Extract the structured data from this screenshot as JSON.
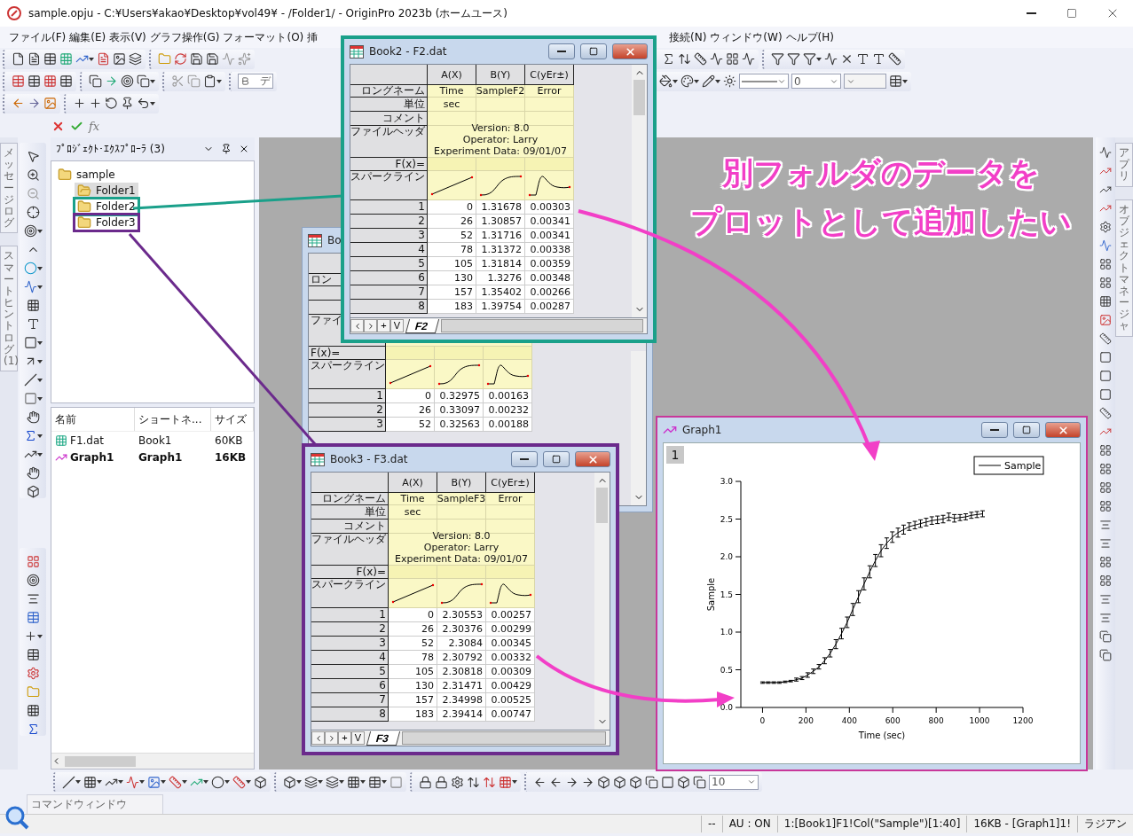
{
  "titlebar": {
    "title": "sample.opju - C:¥Users¥akao¥Desktop¥vol49¥ - /Folder1/ - OriginPro 2023b (ホームユース)"
  },
  "menu": {
    "left": [
      "ファイル(F)",
      "編集(E)",
      "表示(V)",
      "グラフ操作(G)",
      "フォーマット(O)",
      "挿"
    ],
    "right": [
      "接続(N)",
      "ウィンドウ(W)",
      "ヘルプ(H)"
    ]
  },
  "style_toolbar": {
    "font_field": "デ",
    "width_field": "0"
  },
  "formula_bar": {
    "fx": "fx"
  },
  "side_tabs": {
    "left": [
      "メッセージログ",
      "スマートヒントログ (1)"
    ],
    "right": [
      "アプリ",
      "オブジェクトマネージャ"
    ]
  },
  "project_explorer": {
    "title": "ﾌﾟﾛｼﾞｪｸﾄ･ｴｸｽﾌﾟﾛｰﾗ (3)",
    "tree": [
      {
        "label": "sample",
        "selected": false,
        "children": [
          {
            "label": "Folder1",
            "selected": true
          },
          {
            "label": "Folder2",
            "selected": false,
            "color": "#1aa08a"
          },
          {
            "label": "Folder3",
            "selected": false,
            "color": "#6b2a8c"
          }
        ]
      }
    ],
    "columns": [
      "名前",
      "ショートネ...",
      "サイズ"
    ],
    "items": [
      {
        "kind": "workbook",
        "name": "F1.dat",
        "short_name": "Book1",
        "size": "60KB",
        "active": false
      },
      {
        "kind": "graph",
        "name": "Graph1",
        "short_name": "Graph1",
        "size": "16KB",
        "active": true
      }
    ]
  },
  "workbooks": [
    {
      "title": "Bo",
      "row_labels": {
        "long_name": "ロン",
        "file_header": "ファイ",
        "formula": "F(x)=",
        "sparkline": "スパークライン"
      },
      "columns": [
        {
          "kind": "linear"
        },
        {
          "kind": "sigmoid"
        },
        {
          "kind": "peak"
        }
      ],
      "rows": [
        {
          "number": "1",
          "cells": [
            "0",
            "0.32975",
            "0.00163"
          ]
        },
        {
          "number": "2",
          "cells": [
            "26",
            "0.33097",
            "0.00232"
          ]
        },
        {
          "number": "3",
          "cells": [
            "52",
            "0.32563",
            "0.00188"
          ]
        }
      ]
    },
    {
      "title": "Book2 - F2.dat",
      "color": "#1aa08a",
      "row_labels": {
        "long_name": "ロングネーム",
        "units": "単位",
        "comment": "コメント",
        "file_header": "ファイルヘッダ",
        "formula": "F(x)=",
        "sparkline": "スパークライン"
      },
      "columns": [
        {
          "label": "A(X)",
          "long_name": "Time",
          "units": "sec",
          "kind": "linear"
        },
        {
          "label": "B(Y)",
          "long_name": "SampleF2",
          "kind": "sigmoid"
        },
        {
          "label": "C(yEr±)",
          "long_name": "Error",
          "kind": "peak"
        }
      ],
      "file_header": [
        "Version: 8.0",
        "Operator: Larry",
        "Experiment Data: 09/01/07"
      ],
      "rows": [
        {
          "number": "1",
          "cells": [
            "0",
            "1.31678",
            "0.00303"
          ]
        },
        {
          "number": "2",
          "cells": [
            "26",
            "1.30857",
            "0.00341"
          ]
        },
        {
          "number": "3",
          "cells": [
            "52",
            "1.31716",
            "0.00341"
          ]
        },
        {
          "number": "4",
          "cells": [
            "78",
            "1.31372",
            "0.00338"
          ]
        },
        {
          "number": "5",
          "cells": [
            "105",
            "1.31814",
            "0.00359"
          ]
        },
        {
          "number": "6",
          "cells": [
            "130",
            "1.3276",
            "0.00348"
          ]
        },
        {
          "number": "7",
          "cells": [
            "157",
            "1.35402",
            "0.00266"
          ]
        },
        {
          "number": "8",
          "cells": [
            "183",
            "1.39754",
            "0.00287"
          ]
        }
      ],
      "sheet_nav": [
        "+",
        "V"
      ],
      "sheet_tab": "F2"
    },
    {
      "title": "Book3 - F3.dat",
      "color": "#6b2a8c",
      "row_labels": {
        "long_name": "ロングネーム",
        "units": "単位",
        "comment": "コメント",
        "file_header": "ファイルヘッダ",
        "formula": "F(x)=",
        "sparkline": "スパークライン"
      },
      "columns": [
        {
          "label": "A(X)",
          "long_name": "Time",
          "units": "sec",
          "kind": "linear"
        },
        {
          "label": "B(Y)",
          "long_name": "SampleF3",
          "kind": "sigmoid"
        },
        {
          "label": "C(yEr±)",
          "long_name": "Error",
          "kind": "peak"
        }
      ],
      "file_header": [
        "Version: 8.0",
        "Operator: Larry",
        "Experiment Data: 09/01/07"
      ],
      "rows": [
        {
          "number": "1",
          "cells": [
            "0",
            "2.30553",
            "0.00257"
          ]
        },
        {
          "number": "2",
          "cells": [
            "26",
            "2.30376",
            "0.00299"
          ]
        },
        {
          "number": "3",
          "cells": [
            "52",
            "2.3084",
            "0.00345"
          ]
        },
        {
          "number": "4",
          "cells": [
            "78",
            "2.30792",
            "0.00332"
          ]
        },
        {
          "number": "5",
          "cells": [
            "105",
            "2.30818",
            "0.00309"
          ]
        },
        {
          "number": "6",
          "cells": [
            "130",
            "2.31471",
            "0.00429"
          ]
        },
        {
          "number": "7",
          "cells": [
            "157",
            "2.34998",
            "0.00525"
          ]
        },
        {
          "number": "8",
          "cells": [
            "183",
            "2.39414",
            "0.00747"
          ]
        }
      ],
      "sheet_nav": [
        "+",
        "V"
      ],
      "sheet_tab": "F3"
    }
  ],
  "graph": {
    "title": "Graph1",
    "color": "#c8379a",
    "layer": "1",
    "chart_data": {
      "type": "line",
      "xlabel": "Time (sec)",
      "ylabel": "Sample",
      "xlim": [
        -100,
        1200
      ],
      "ylim": [
        0,
        3
      ],
      "xticks": [
        0,
        200,
        400,
        600,
        800,
        1000,
        1200
      ],
      "yticks": [
        {
          "value": 0,
          "label": "0.0"
        },
        {
          "value": 0.5,
          "label": "0.5"
        },
        {
          "value": 1,
          "label": "1.0"
        },
        {
          "value": 1.5,
          "label": "1.5"
        },
        {
          "value": 2,
          "label": "2.0"
        },
        {
          "value": 2.5,
          "label": "2.5"
        },
        {
          "value": 3,
          "label": "3.0"
        }
      ],
      "x": [
        0,
        26,
        52,
        78,
        104,
        130,
        156,
        182,
        208,
        234,
        260,
        286,
        312,
        338,
        364,
        390,
        416,
        442,
        468,
        494,
        520,
        546,
        572,
        598,
        624,
        650,
        676,
        702,
        728,
        754,
        780,
        806,
        832,
        858,
        884,
        910,
        936,
        962,
        988,
        1014
      ],
      "series": [
        {
          "name": "Sample",
          "color": "#000000",
          "values": [
            0.33,
            0.33,
            0.33,
            0.33,
            0.34,
            0.35,
            0.37,
            0.39,
            0.43,
            0.48,
            0.54,
            0.62,
            0.72,
            0.84,
            0.98,
            1.13,
            1.3,
            1.47,
            1.64,
            1.8,
            1.95,
            2.08,
            2.18,
            2.26,
            2.32,
            2.36,
            2.4,
            2.42,
            2.44,
            2.46,
            2.48,
            2.49,
            2.5,
            2.53,
            2.51,
            2.52,
            2.53,
            2.55,
            2.56,
            2.57
          ],
          "errors": [
            0.01,
            0.01,
            0.01,
            0.01,
            0.01,
            0.01,
            0.02,
            0.02,
            0.03,
            0.03,
            0.03,
            0.04,
            0.05,
            0.06,
            0.07,
            0.07,
            0.08,
            0.08,
            0.08,
            0.08,
            0.08,
            0.08,
            0.07,
            0.07,
            0.06,
            0.06,
            0.05,
            0.05,
            0.05,
            0.05,
            0.05,
            0.05,
            0.05,
            0.05,
            0.05,
            0.04,
            0.04,
            0.04,
            0.04,
            0.04
          ]
        }
      ]
    }
  },
  "annotation": [
    "別フォルダのデータを",
    "プロットとして追加したい"
  ],
  "bottom_toolbar": {
    "size_field": "10"
  },
  "command_window": {
    "label": "コマンドウィンドウ"
  },
  "status_bar": [
    "--",
    "AU : ON",
    "1:[Book1]F1!Col(\"Sample\")[1:40]",
    "16KB - [Graph1]1!",
    "ラジアン"
  ]
}
